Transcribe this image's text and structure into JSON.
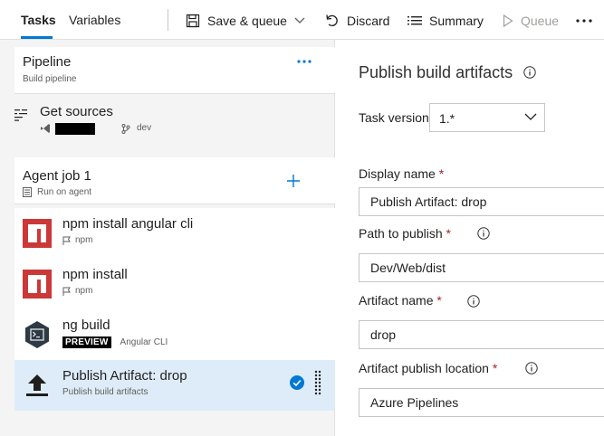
{
  "tabs": {
    "tasks": "Tasks",
    "variables": "Variables"
  },
  "toolbar": {
    "save_queue": "Save & queue",
    "discard": "Discard",
    "summary": "Summary",
    "queue": "Queue"
  },
  "pipeline": {
    "title": "Pipeline",
    "subtitle": "Build pipeline"
  },
  "sources": {
    "title": "Get sources",
    "branch": "dev"
  },
  "agent_job": {
    "title": "Agent job 1",
    "subtitle": "Run on agent"
  },
  "tasks": [
    {
      "title": "npm install angular cli",
      "subtitle": "npm"
    },
    {
      "title": "npm install",
      "subtitle": "npm"
    },
    {
      "title": "ng build",
      "badge": "PREVIEW",
      "subtitle": "Angular CLI"
    },
    {
      "title": "Publish Artifact: drop",
      "subtitle": "Publish build artifacts"
    }
  ],
  "details": {
    "title": "Publish build artifacts",
    "task_version_label": "Task version",
    "task_version_value": "1.*",
    "display_name_label": "Display name",
    "display_name_value": "Publish Artifact: drop",
    "path_label": "Path to publish",
    "path_value": "Dev/Web/dist",
    "artifact_name_label": "Artifact name",
    "artifact_name_value": "drop",
    "location_label": "Artifact publish location",
    "location_value": "Azure Pipelines",
    "required_marker": "*"
  },
  "colors": {
    "accent": "#0078d4",
    "npm_red": "#cb3837",
    "selected_bg": "#deecf9",
    "required": "#a4262c"
  }
}
